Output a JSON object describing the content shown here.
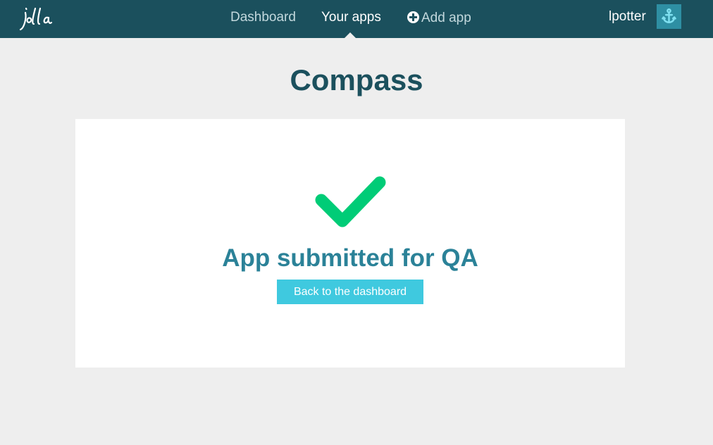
{
  "header": {
    "logo_text": "jolla",
    "nav": {
      "dashboard": "Dashboard",
      "your_apps": "Your apps",
      "add_app": "Add app"
    },
    "active_nav": "Your apps",
    "username": "lpotter",
    "avatar_icon": "anchor-icon"
  },
  "main": {
    "title": "Compass",
    "status_icon": "check-icon",
    "status_message": "App submitted for QA",
    "back_button_label": "Back to the dashboard"
  },
  "colors": {
    "topbar": "#1b505d",
    "page_background": "#eeeeee",
    "title": "#1b505d",
    "status_message": "#2b8298",
    "check": "#00cc77",
    "button": "#3fc9df",
    "avatar": "#2e8fa3"
  }
}
